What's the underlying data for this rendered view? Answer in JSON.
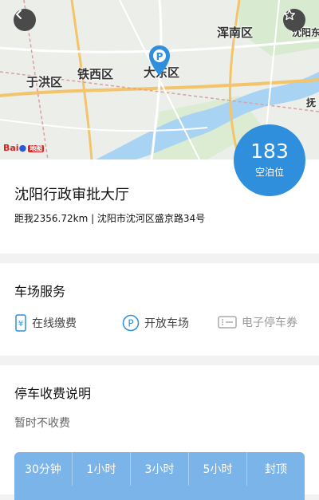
{
  "map": {
    "districts": [
      "浑南区",
      "铁西区",
      "大东区",
      "于洪区",
      "沈阳东",
      "抚"
    ],
    "provider": "Bai",
    "provider_suffix": "地图"
  },
  "parking": {
    "name": "沈阳行政审批大厅",
    "detail": "距我2356.72km | 沈阳市沈河区盛京路34号",
    "available_count": "183",
    "available_label": "空泊位"
  },
  "services": {
    "title": "车场服务",
    "items": [
      "在线缴费",
      "开放车场",
      "电子停车券"
    ]
  },
  "fees": {
    "title": "停车收费说明",
    "note": "暂时不收费",
    "columns": [
      "30分钟",
      "1小时",
      "3小时",
      "5小时",
      "封顶"
    ]
  },
  "colors": {
    "accent": "#2f8fdc",
    "table_header": "#7ab4e8",
    "river": "#a9d3f2"
  }
}
